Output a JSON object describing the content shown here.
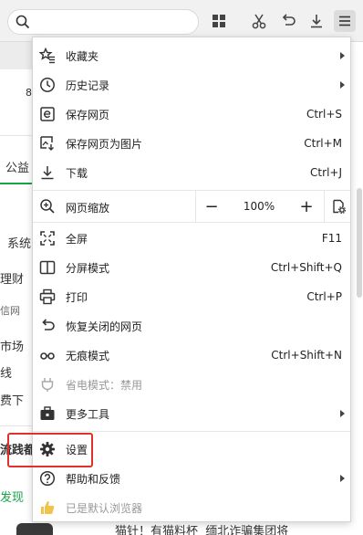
{
  "background": {
    "row1": "8",
    "row2": "公益",
    "row3": "系统",
    "row4": "理财",
    "row5": "信网",
    "row6": "市场",
    "row7": "线",
    "row8": "费下",
    "row9": "流践都",
    "row10": "发现",
    "bottom_text": "猫针！有猫料杯  缅北诈骗集团将"
  },
  "menu": {
    "items": [
      {
        "label": "收藏夹",
        "shortcut": "",
        "icon": "star-list-icon",
        "submenu": true
      },
      {
        "label": "历史记录",
        "shortcut": "",
        "icon": "clock-icon",
        "submenu": true
      },
      {
        "label": "保存网页",
        "shortcut": "Ctrl+S",
        "icon": "save-page-icon"
      },
      {
        "label": "保存网页为图片",
        "shortcut": "Ctrl+M",
        "icon": "save-image-icon"
      },
      {
        "label": "下载",
        "shortcut": "Ctrl+J",
        "icon": "download-icon"
      }
    ],
    "zoom": {
      "label": "网页缩放",
      "minus": "−",
      "value": "100%",
      "plus": "+"
    },
    "items2": [
      {
        "label": "全屏",
        "shortcut": "F11",
        "icon": "fullscreen-icon"
      },
      {
        "label": "分屏模式",
        "shortcut": "Ctrl+Shift+Q",
        "icon": "split-screen-icon"
      },
      {
        "label": "打印",
        "shortcut": "Ctrl+P",
        "icon": "print-icon"
      },
      {
        "label": "恢复关闭的网页",
        "shortcut": "",
        "icon": "restore-icon"
      },
      {
        "label": "无痕模式",
        "shortcut": "Ctrl+Shift+N",
        "icon": "incognito-icon"
      },
      {
        "label": "省电模式：禁用",
        "shortcut": "",
        "icon": "power-plug-icon",
        "disabled": true
      },
      {
        "label": "更多工具",
        "shortcut": "",
        "icon": "toolbox-icon",
        "submenu": true
      }
    ],
    "items3": [
      {
        "label": "设置",
        "icon": "gear-icon"
      },
      {
        "label": "帮助和反馈",
        "icon": "help-icon",
        "submenu": true
      },
      {
        "label": "已是默认浏览器",
        "icon": "thumbs-up-icon",
        "disabled": true
      }
    ]
  },
  "colors": {
    "highlight": "#e0312a",
    "accent_green": "#1aa34a"
  }
}
